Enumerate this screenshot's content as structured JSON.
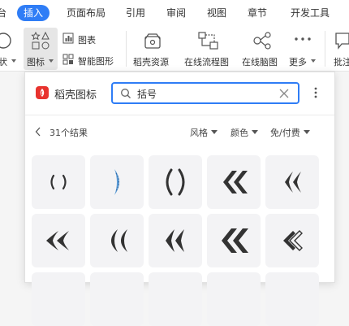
{
  "menubar": {
    "tabs": [
      "台",
      "插入",
      "页面布局",
      "引用",
      "审阅",
      "视图",
      "章节",
      "开发工具"
    ],
    "active_tab": "插入"
  },
  "ribbon": {
    "shape_label": "状",
    "icon_label": "图标",
    "chart_label": "图表",
    "smartart_label": "智能图形",
    "daoke_label": "稻壳资源",
    "flowchart_label": "在线流程图",
    "mindmap_label": "在线脑图",
    "more_label": "更多",
    "comment_label": "批注"
  },
  "panel": {
    "brand": "稻壳图标",
    "search_value": "括号",
    "results_text": "31个结果",
    "filters": [
      "风格",
      "颜色",
      "免/付费"
    ]
  },
  "colors": {
    "accent": "#2f7df6",
    "brand": "#e8332e",
    "tile_bg": "#f3f3f5",
    "icon_dark": "#333333",
    "icon_blue": "#5b9bd5"
  },
  "icons": [
    "parentheses-thin-icon",
    "blue-bracket-icon",
    "parentheses-bold-icon",
    "double-chevron-left-icon",
    "curved-double-left-icon",
    "curved-double-left-icon",
    "crescent-double-left-icon",
    "curved-double-left-icon",
    "double-chevron-left-icon",
    "outline-double-chevron-icon"
  ]
}
